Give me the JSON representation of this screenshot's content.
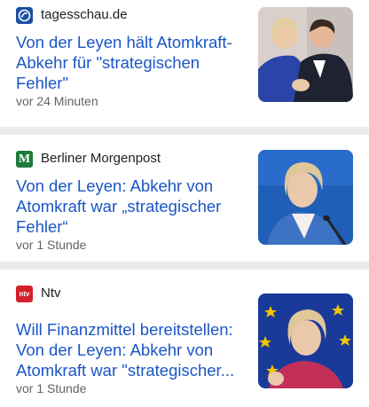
{
  "articles": [
    {
      "source": "tagesschau.de",
      "headline": "Von der Leyen hält Atomkraft-Abkehr für \"strategischen Fehler\"",
      "time": "vor 24 Minuten",
      "logo_color": "#1b4fa0"
    },
    {
      "source": "Berliner Morgenpost",
      "headline": "Von der Leyen: Abkehr von Atomkraft war „strategischer Fehler“",
      "time": "vor 1 Stunde",
      "logo_color": "#1e7a3a",
      "logo_letter": "M"
    },
    {
      "source": "Ntv",
      "headline": "Will Finanzmittel bereitstellen: Von der Leyen: Abkehr von Atomkraft war \"strategischer...",
      "time": "vor 1 Stunde",
      "logo_color": "#d4202a",
      "logo_letter": "ntv"
    }
  ],
  "colors": {
    "headline": "#1a56c5",
    "source": "#202124",
    "time": "#5f6368",
    "divider": "#ebebeb"
  }
}
